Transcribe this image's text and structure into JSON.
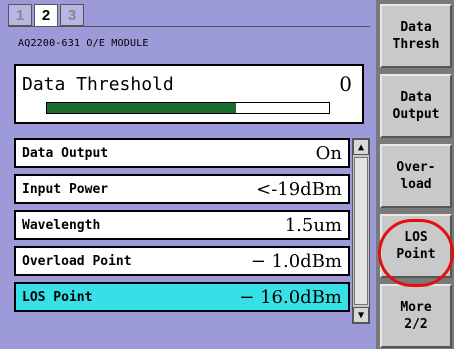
{
  "tabs": [
    "1",
    "2",
    "3"
  ],
  "module_title": "AQ2200-631 O/E MODULE",
  "threshold": {
    "label": "Data Threshold",
    "value": "0",
    "bar_fill_fraction": 0.67,
    "bar_color": "#176b2c"
  },
  "rows": [
    {
      "label": "Data Output",
      "value": "On"
    },
    {
      "label": "Input Power",
      "value": "<-19dBm"
    },
    {
      "label": "Wavelength",
      "value": "1.5um"
    },
    {
      "label": "Overload Point",
      "value": "−  1.0dBm"
    },
    {
      "label": "LOS Point",
      "value": "− 16.0dBm"
    }
  ],
  "selected_row_color": "#36e0e6",
  "softkeys": [
    {
      "label": "Data\nThresh"
    },
    {
      "label": "Data\nOutput"
    },
    {
      "label": "Over-\nload"
    },
    {
      "label": "LOS\nPoint"
    },
    {
      "label": "More\n2/2"
    }
  ],
  "highlight_color": "#e01010",
  "scroll_up_icon": "triangle-up",
  "scroll_down_icon": "triangle-down"
}
